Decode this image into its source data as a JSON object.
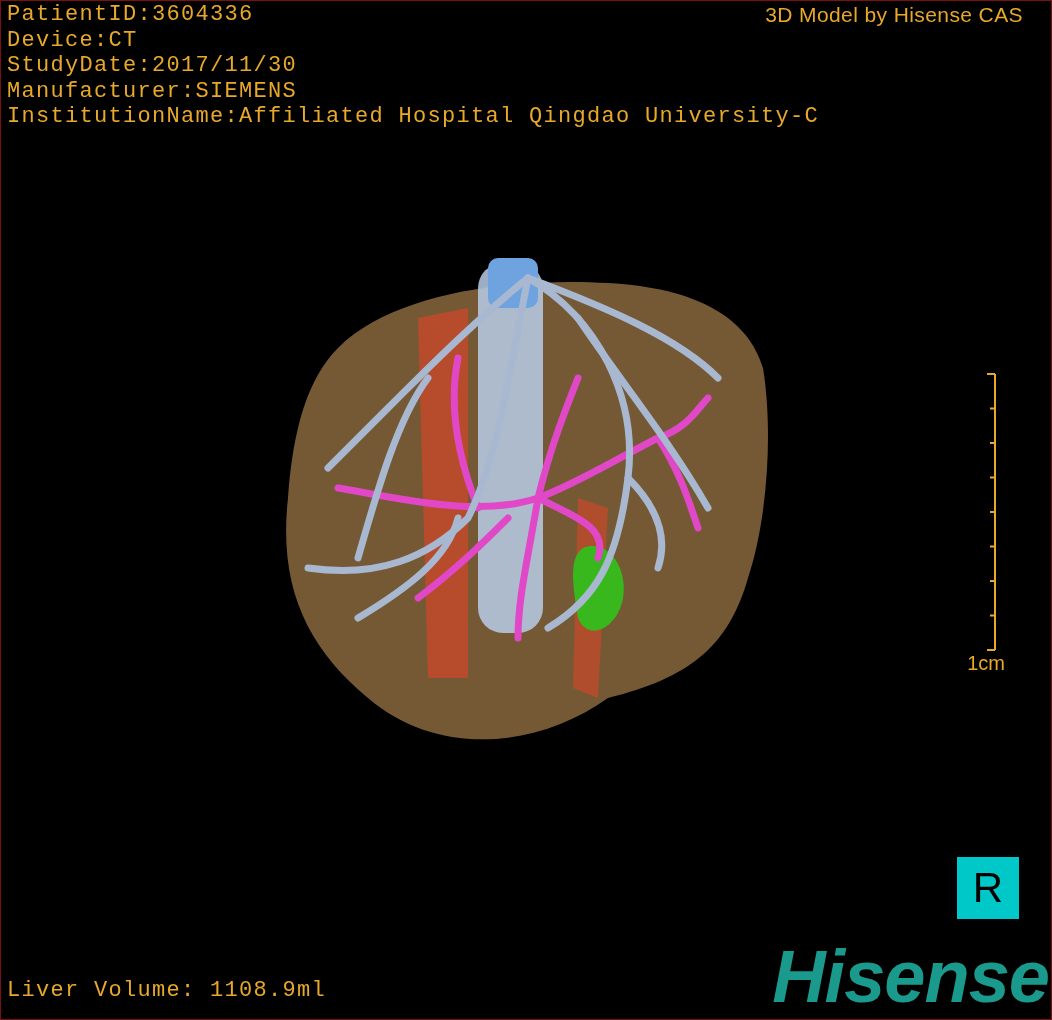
{
  "info_lines": [
    "PatientID:3604336",
    "Device:CT",
    "StudyDate:2017/11/30",
    "Manufacturer:SIEMENS",
    "InstitutionName:Affiliated Hospital Qingdao University-C"
  ],
  "credit": "3D Model by Hisense CAS",
  "scale": {
    "label": "1cm"
  },
  "orientation": {
    "label": "R"
  },
  "liver_volume": "Liver Volume: 1108.9ml",
  "logo": {
    "text": "Hisense"
  }
}
